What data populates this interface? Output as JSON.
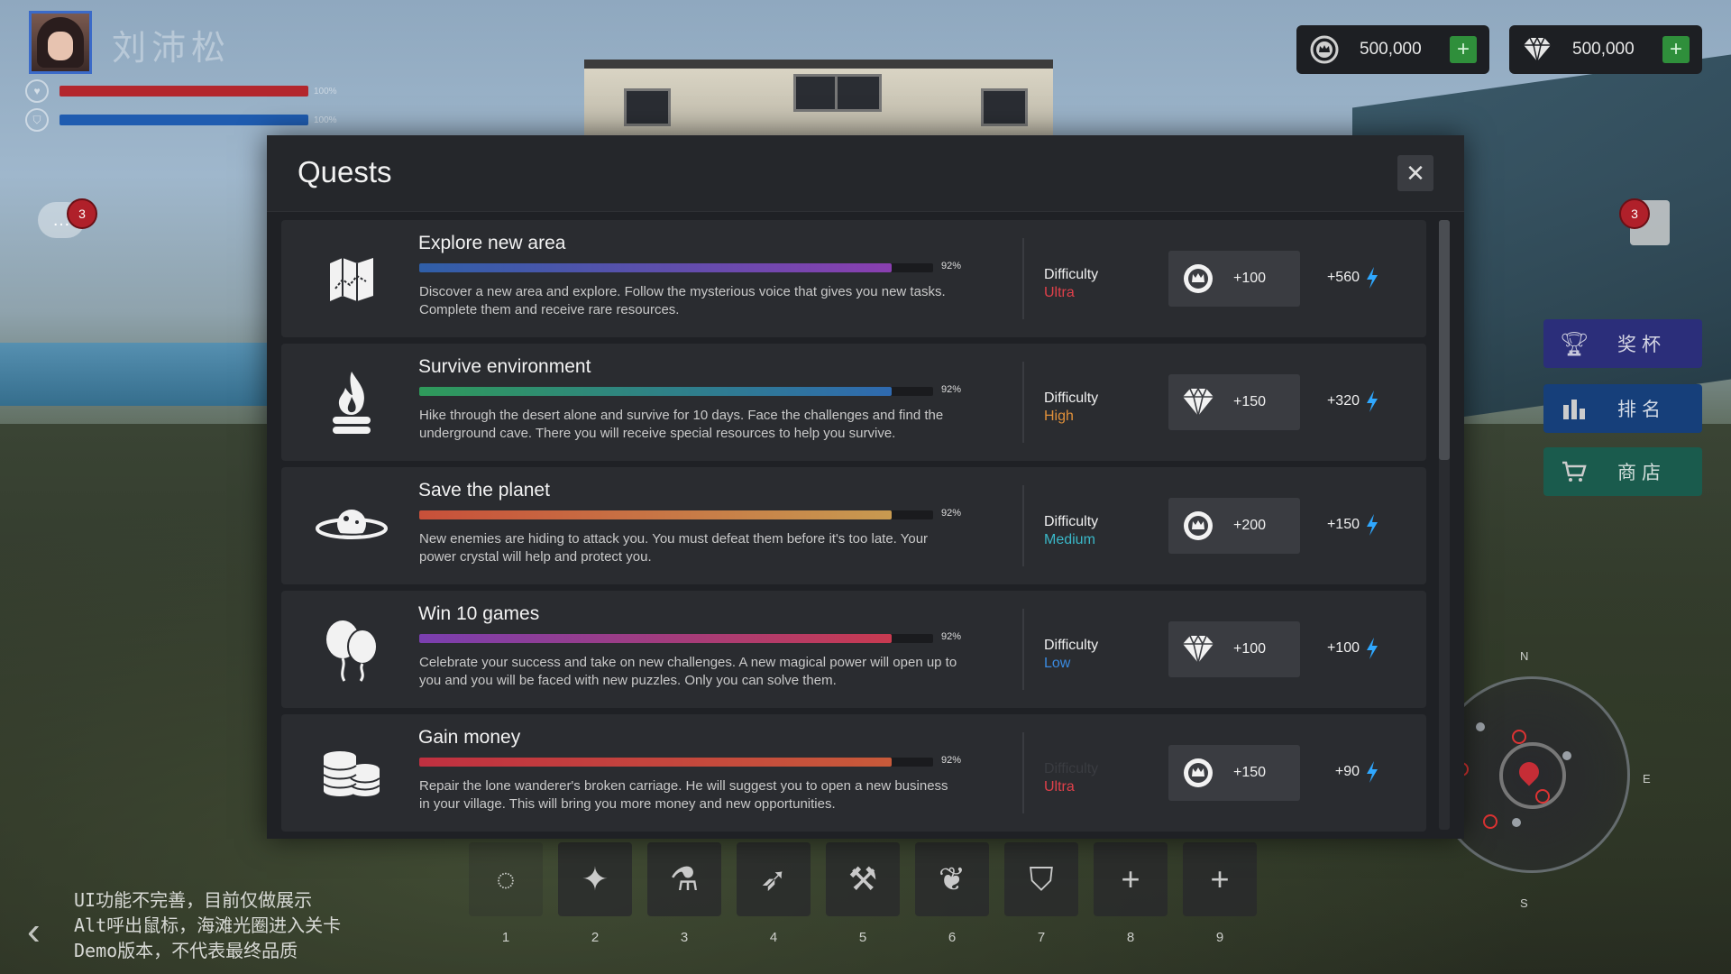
{
  "player": {
    "name": "刘沛松",
    "health_pct": "100%",
    "shield_pct": "100%",
    "health_color": "#b3262d",
    "shield_color": "#1f5cb0"
  },
  "chat": {
    "badge": "3"
  },
  "notifications": {
    "badge": "3"
  },
  "currencies": [
    {
      "icon": "crown-coin-icon",
      "value": "500,000"
    },
    {
      "icon": "diamond-icon",
      "value": "500,000"
    }
  ],
  "side_menu": [
    {
      "icon": "trophy-icon",
      "label": "奖杯",
      "color": "#2b2e7a"
    },
    {
      "icon": "bar-chart-icon",
      "label": "排名",
      "color": "#163f7a"
    },
    {
      "icon": "cart-icon",
      "label": "商店",
      "color": "#1a5b4d"
    }
  ],
  "compass": {
    "n": "N",
    "e": "E",
    "s": "S"
  },
  "dev_note": [
    "UI功能不完善，目前仅做展示",
    "Alt呼出鼠标，海滩光圈进入关卡",
    "Demo版本，不代表最终品质"
  ],
  "hotbar": [
    {
      "num": "1",
      "icon": "ring-icon",
      "glyph": "◌"
    },
    {
      "num": "2",
      "icon": "wand-icon",
      "glyph": "✦"
    },
    {
      "num": "3",
      "icon": "potion-icon",
      "glyph": "⚗"
    },
    {
      "num": "4",
      "icon": "bow-icon",
      "glyph": "➶"
    },
    {
      "num": "5",
      "icon": "double-axe-icon",
      "glyph": "⚒"
    },
    {
      "num": "6",
      "icon": "leaf-icon",
      "glyph": "❦"
    },
    {
      "num": "7",
      "icon": "shield-icon",
      "glyph": "⛉"
    },
    {
      "num": "8",
      "icon": "plus-icon",
      "glyph": "+"
    },
    {
      "num": "9",
      "icon": "plus-icon",
      "glyph": "+"
    }
  ],
  "quests_modal": {
    "title": "Quests",
    "close_icon": "close-icon",
    "quests": [
      {
        "icon": "map-icon",
        "title": "Explore new area",
        "progress": 0.92,
        "progress_label": "92%",
        "bar_colors": [
          "#2f5fa8",
          "#8a3fb0"
        ],
        "description": "Discover a new area and explore. Follow the mysterious voice that gives you new tasks. Complete them and receive rare resources.",
        "difficulty_label": "Difficulty",
        "difficulty": "Ultra",
        "difficulty_color": "#e0404a",
        "reward_icon": "crown-coin-icon",
        "reward": "+100",
        "energy": "+560"
      },
      {
        "icon": "campfire-icon",
        "title": "Survive environment",
        "progress": 0.92,
        "progress_label": "92%",
        "bar_colors": [
          "#2f9a5a",
          "#2f6ab0"
        ],
        "description": "Hike through the desert alone and survive for 10 days. Face the challenges and find the underground cave. There you will receive special resources to help you survive.",
        "difficulty_label": "Difficulty",
        "difficulty": "High",
        "difficulty_color": "#e0903a",
        "reward_icon": "diamond-icon",
        "reward": "+150",
        "energy": "+320"
      },
      {
        "icon": "planet-icon",
        "title": "Save the planet",
        "progress": 0.92,
        "progress_label": "92%",
        "bar_colors": [
          "#c8503a",
          "#c89a50"
        ],
        "description": "New enemies are hiding to attack you. You must defeat them before it's too late. Your power crystal will help and protect you.",
        "difficulty_label": "Difficulty",
        "difficulty": "Medium",
        "difficulty_color": "#3ab8c8",
        "reward_icon": "crown-coin-icon",
        "reward": "+200",
        "energy": "+150"
      },
      {
        "icon": "balloons-icon",
        "title": "Win 10 games",
        "progress": 0.92,
        "progress_label": "92%",
        "bar_colors": [
          "#7a3fb0",
          "#c83a50"
        ],
        "description": "Celebrate your success and take on new challenges. A new magical power will open up to you and you will be faced with new puzzles. Only you can solve them.",
        "difficulty_label": "Difficulty",
        "difficulty": "Low",
        "difficulty_color": "#3a8ae0",
        "reward_icon": "diamond-icon",
        "reward": "+100",
        "energy": "+100"
      },
      {
        "icon": "coins-stack-icon",
        "title": "Gain money",
        "progress": 0.92,
        "progress_label": "92%",
        "bar_colors": [
          "#c03040",
          "#c85a3a"
        ],
        "description": "Repair the lone wanderer's broken carriage. He will suggest you to open a new business in your village. This will bring you more money and new opportunities.",
        "difficulty_label": "Difficulty",
        "difficulty": "Ultra",
        "difficulty_color": "#e0404a",
        "reward_icon": "crown-coin-icon",
        "reward": "+150",
        "energy": "+90"
      }
    ]
  },
  "accent": {
    "energy": "#2fa8ff",
    "plus_green": "#2f8f3b"
  }
}
